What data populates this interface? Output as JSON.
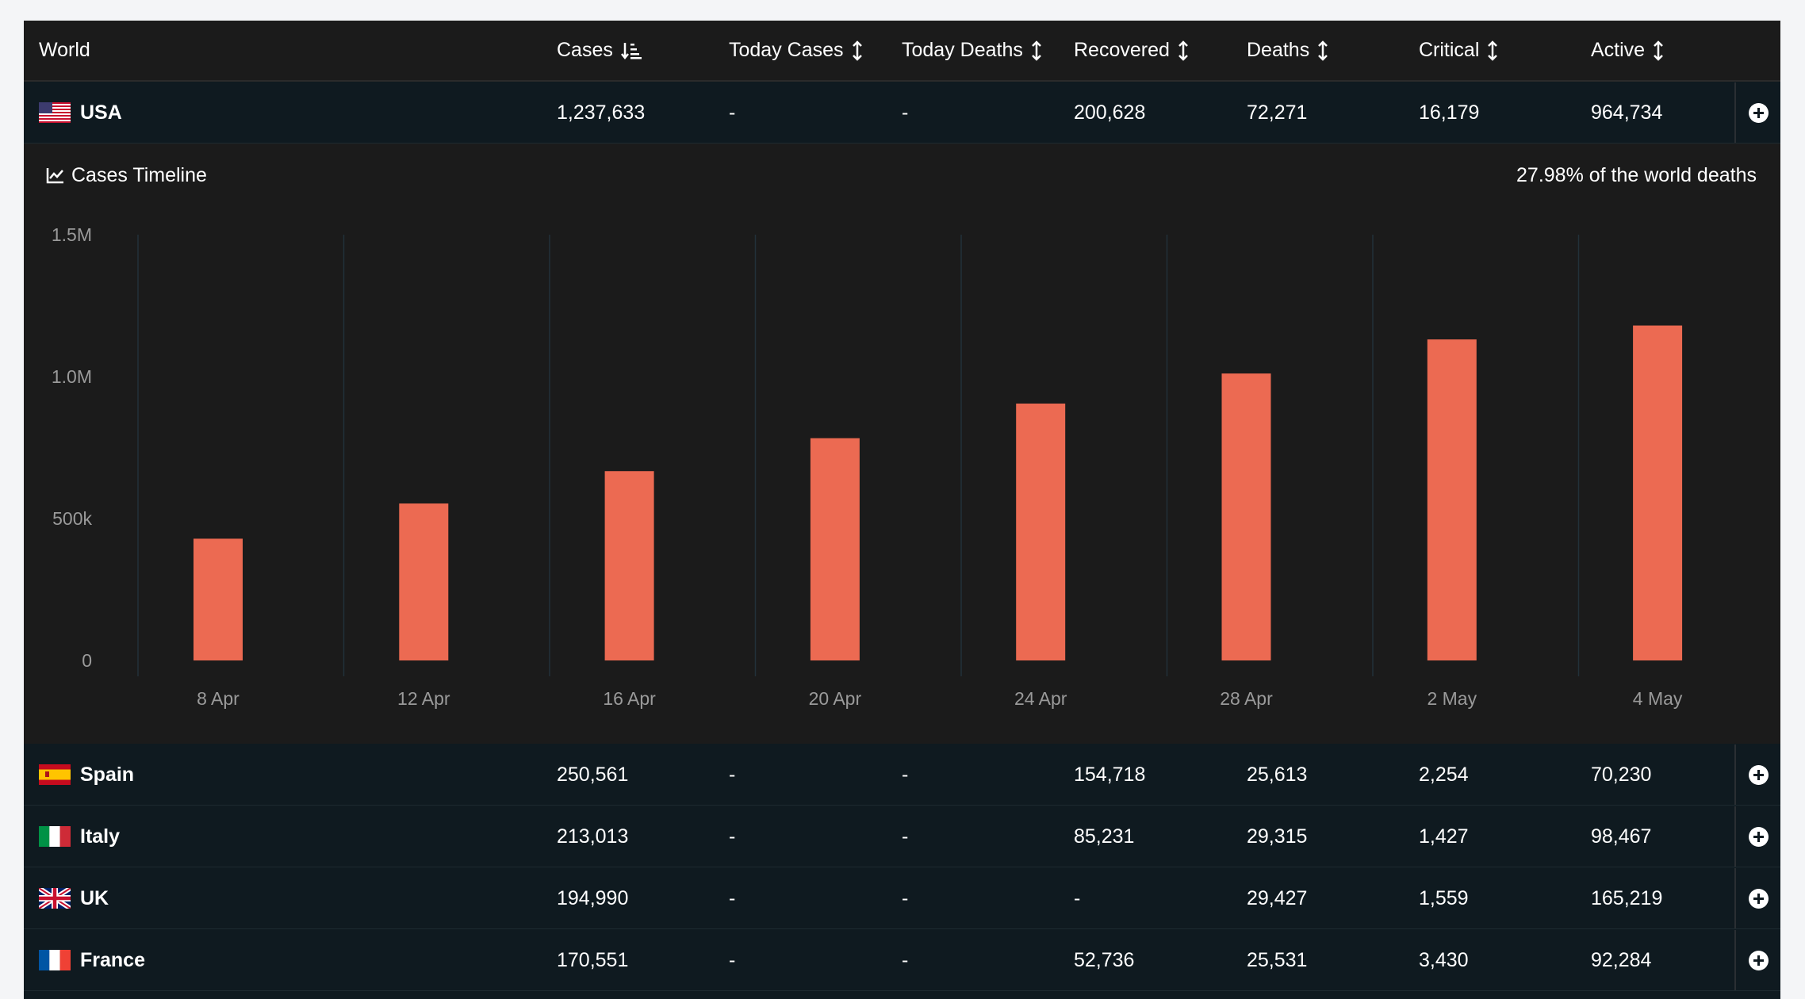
{
  "table": {
    "headers": [
      "World",
      "Cases",
      "Today Cases",
      "Today Deaths",
      "Recovered",
      "Deaths",
      "Critical",
      "Active"
    ],
    "rows_top": [
      {
        "country": "USA",
        "flag": "us-flag-icon",
        "values": [
          "1,237,633",
          "-",
          "-",
          "200,628",
          "72,271",
          "16,179",
          "964,734"
        ]
      }
    ],
    "rows_bottom": [
      {
        "country": "Spain",
        "flag": "spain-flag-icon",
        "values": [
          "250,561",
          "-",
          "-",
          "154,718",
          "25,613",
          "2,254",
          "70,230"
        ]
      },
      {
        "country": "Italy",
        "flag": "italy-flag-icon",
        "values": [
          "213,013",
          "-",
          "-",
          "85,231",
          "29,315",
          "1,427",
          "98,467"
        ]
      },
      {
        "country": "UK",
        "flag": "uk-flag-icon",
        "values": [
          "194,990",
          "-",
          "-",
          "-",
          "29,427",
          "1,559",
          "165,219"
        ]
      },
      {
        "country": "France",
        "flag": "france-flag-icon",
        "values": [
          "170,551",
          "-",
          "-",
          "52,736",
          "25,531",
          "3,430",
          "92,284"
        ]
      }
    ]
  },
  "expanded": {
    "title": "Cases Timeline",
    "stat": "27.98% of the world deaths"
  },
  "colors": {
    "bar": "#ec6a52",
    "panel_dark": "#0f1a20",
    "chart_bg": "#1b1b1b"
  },
  "chart_data": {
    "type": "bar",
    "categories": [
      "8 Apr",
      "12 Apr",
      "16 Apr",
      "20 Apr",
      "24 Apr",
      "28 Apr",
      "2 May",
      "4 May"
    ],
    "values": [
      429000,
      553000,
      667000,
      783000,
      905000,
      1011000,
      1131000,
      1180000
    ],
    "yticks": [
      {
        "value": 0,
        "label": "0"
      },
      {
        "value": 500000,
        "label": "500k"
      },
      {
        "value": 1000000,
        "label": "1.0M"
      },
      {
        "value": 1500000,
        "label": "1.5M"
      }
    ],
    "ylim": [
      0,
      1500000
    ],
    "grid": "vertical"
  }
}
